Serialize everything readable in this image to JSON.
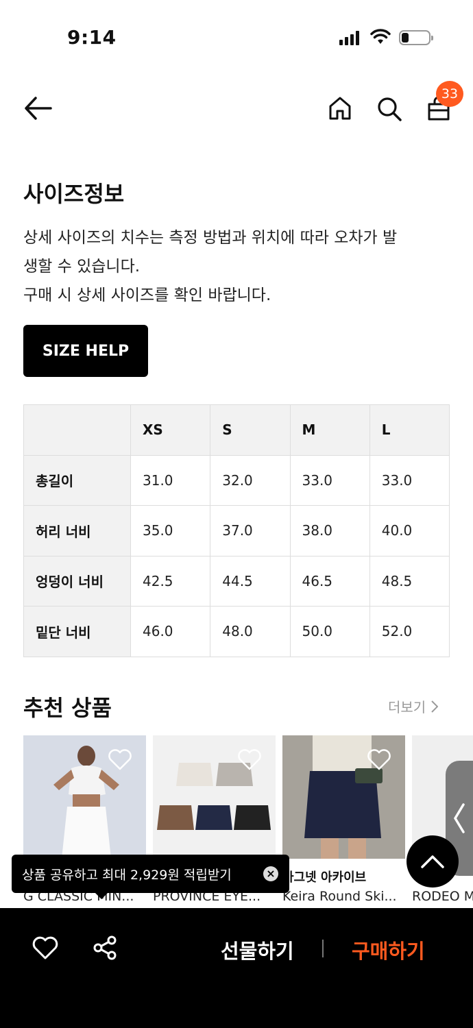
{
  "status": {
    "time": "9:14"
  },
  "nav": {
    "cart_count": "33"
  },
  "size_info": {
    "title": "사이즈정보",
    "desc_line1": "상세 사이즈의 치수는 측정 방법과 위치에 따라 오차가 발",
    "desc_line2": "생할 수 있습니다.",
    "desc_line3": "구매 시 상세 사이즈를 확인 바랍니다.",
    "size_help_label": "SIZE HELP"
  },
  "size_table": {
    "headers": [
      "",
      "XS",
      "S",
      "M",
      "L"
    ],
    "rows": [
      {
        "label": "총길이",
        "values": [
          "31.0",
          "32.0",
          "33.0",
          "33.0"
        ]
      },
      {
        "label": "허리 너비",
        "values": [
          "35.0",
          "37.0",
          "38.0",
          "40.0"
        ]
      },
      {
        "label": "엉덩이 너비",
        "values": [
          "42.5",
          "44.5",
          "46.5",
          "48.5"
        ]
      },
      {
        "label": "밑단 너비",
        "values": [
          "46.0",
          "48.0",
          "50.0",
          "52.0"
        ]
      }
    ]
  },
  "recommend": {
    "title": "추천 상품",
    "more_label": "더보기",
    "products": [
      {
        "brand": "",
        "name": "G CLASSIC MIN..."
      },
      {
        "brand": "",
        "name": "PROVINCE EYE..."
      },
      {
        "brand": "마그넷 아카이브",
        "name": "Keira Round Ski..."
      },
      {
        "brand": "",
        "name": "RODEO M"
      }
    ]
  },
  "toast": {
    "text": "상품 공유하고 최대 2,929원 적립받기"
  },
  "bottom_bar": {
    "gift_label": "선물하기",
    "buy_label": "구매하기"
  },
  "colors": {
    "accent": "#ff5a1f",
    "bar": "#000000"
  }
}
